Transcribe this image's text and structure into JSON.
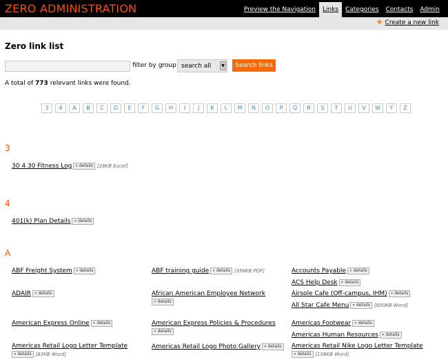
{
  "app": {
    "title": "ZERO ADMINISTRATION",
    "nav": [
      "Preview the Navigation",
      "Links",
      "Categories",
      "Contacts",
      "Admin"
    ],
    "create_link": "Create a new link"
  },
  "page": {
    "heading": "Zero link list",
    "filter_label": "filter by group",
    "group_select": "search all",
    "search_button": "Search links",
    "total_prefix": "A total of",
    "total_count": "773",
    "total_suffix": "relevant links were found."
  },
  "alphabet": [
    "3",
    "4",
    "A",
    "B",
    "C",
    "D",
    "E",
    "F",
    "G",
    "H",
    "I",
    "J",
    "K",
    "L",
    "M",
    "N",
    "O",
    "P",
    "Q",
    "R",
    "S",
    "T",
    "U",
    "V",
    "W",
    "Y",
    "Z"
  ],
  "details_label": "details",
  "sections": [
    {
      "letter": "3",
      "links": [
        {
          "title": "30 4 30 Fitness Log",
          "meta": "[28KB Excel]"
        }
      ]
    },
    {
      "letter": "4",
      "links": [
        {
          "title": "401(k) Plan Details",
          "meta": ""
        }
      ]
    },
    {
      "letter": "A",
      "links": [
        {
          "title": "ABF Freight System",
          "meta": ""
        },
        {
          "title": "ABF training guide",
          "meta": "[356KB PDF]"
        },
        {
          "title": "Accounts Payable",
          "meta": ""
        },
        {
          "title": "ACS Help Desk",
          "meta": ""
        },
        {
          "title": "ADAIR",
          "meta": ""
        },
        {
          "title": "African American Employee Network",
          "meta": ""
        },
        {
          "title": "Airsole Cafe (Off-campus, IHM)",
          "meta": ""
        },
        {
          "title": "All Star Cafe Menu",
          "meta": "[650KB Word]"
        },
        {
          "title": "American Express Online",
          "meta": ""
        },
        {
          "title": "American Express Policies & Procedures",
          "meta": ""
        },
        {
          "title": "Americas Footwear",
          "meta": ""
        },
        {
          "title": "Americas Human Resources",
          "meta": ""
        },
        {
          "title": "Americas Retail Logo Letter Template",
          "meta": "[83KB Word]"
        },
        {
          "title": "Americas Retail Logo Photo Gallery",
          "meta": ""
        },
        {
          "title": "Americas Retail Nike Logo Letter Template",
          "meta": "[106KB Word]"
        }
      ]
    }
  ]
}
